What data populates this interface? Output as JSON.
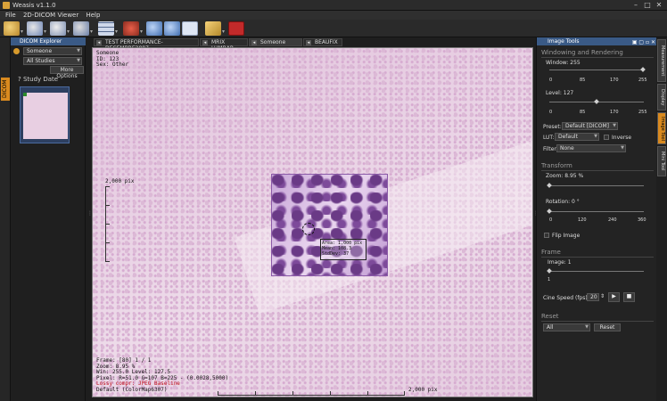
{
  "window": {
    "title": "Weasis v1.1.0",
    "controls": [
      "–",
      "□",
      "✕"
    ]
  },
  "menu": {
    "items": [
      "File",
      "2D-DICOM Viewer",
      "Help"
    ]
  },
  "toolbar": {
    "buttons": [
      {
        "name": "open-icon"
      },
      {
        "name": "import-icon"
      },
      {
        "name": "export-icon"
      },
      {
        "name": "settings-icon"
      },
      {
        "name": "layout-grid-icon"
      },
      {
        "name": "synchronize-icon"
      },
      {
        "name": "zoom-in-icon"
      },
      {
        "name": "zoom-out-icon"
      },
      {
        "name": "zoom-window-icon"
      },
      {
        "name": "measure-icon"
      },
      {
        "name": "delete-icon"
      }
    ]
  },
  "left_tab": {
    "label": "DICOM"
  },
  "explorer": {
    "title": "DICOM Explorer",
    "patient_select": "Someone",
    "studies_select": "All Studies",
    "more_options": "More Options",
    "study_header": "? Study Date"
  },
  "tabs": [
    {
      "label": "TEST PERFORMANCE-DECEMBRE2007",
      "active": false
    },
    {
      "label": "MRIX LUMBAR",
      "active": false
    },
    {
      "label": "Someone",
      "active": true
    },
    {
      "label": "BEAUFIX",
      "active": false
    }
  ],
  "viewer": {
    "overlay_top": [
      "Someone",
      "ID: 123",
      "Sex: Other"
    ],
    "overlay_bottom": [
      "Frame: [80] 1 / 1",
      "Zoom: 8.95 %",
      "Win: 255.0 Level: 127.5",
      "Pixel: R=51.0 G=107 B=225 - (0.0028,5000)",
      "Lossy compr: JPEG Baseline",
      "Default (ColorMap6307)"
    ],
    "ruler_v_label": "2,000 pix",
    "ruler_h_label": "2,000 pix",
    "roi_stats": [
      "Area: 1,000 pix",
      "Mean: 108.3",
      "StdDev: 37"
    ]
  },
  "image_tools": {
    "title": "Image Tools",
    "windowing": {
      "section": "Windowing and Rendering",
      "window_label": "Window: 255",
      "window_ticks": [
        "0",
        "85",
        "170",
        "255"
      ],
      "window_value": 255,
      "level_label": "Level: 127",
      "level_ticks": [
        "0",
        "85",
        "170",
        "255"
      ],
      "level_value": 127,
      "preset_label": "Preset:",
      "preset_value": "Default [DICOM]",
      "lut_label": "LUT:",
      "lut_value": "Default",
      "inverse_label": "Inverse",
      "filter_label": "Filter",
      "filter_value": "None"
    },
    "transform": {
      "section": "Transform",
      "zoom_label": "Zoom: 8.95 %",
      "zoom_value": 8.95,
      "rotation_label": "Rotation: 0 °",
      "rotation_ticks": [
        "0",
        "120",
        "240",
        "360"
      ],
      "rotation_value": 0,
      "flip_label": "Flip Image"
    },
    "frame": {
      "section": "Frame",
      "image_label": "Image: 1",
      "image_tick": "1",
      "cine_label": "Cine Speed (fps):",
      "cine_value": "20",
      "play_icon": "▶",
      "stop_icon": "■"
    },
    "reset": {
      "section": "Reset",
      "select_value": "All",
      "button": "Reset"
    }
  },
  "right_tabs": [
    "Measurement",
    "Display",
    "Image Tool",
    "Mini Tool"
  ]
}
